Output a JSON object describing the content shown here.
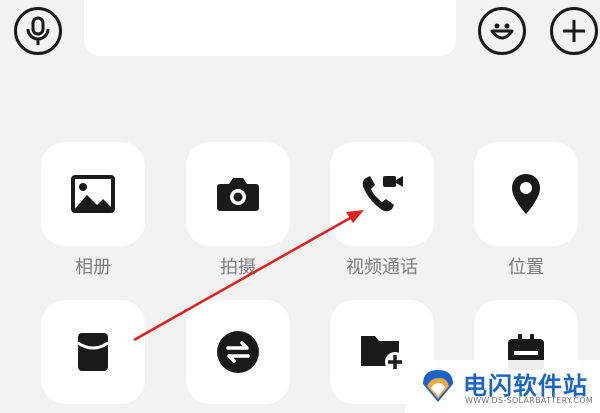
{
  "toolbar": {
    "voice_icon": "microphone-icon",
    "emoji_icon": "emoji-icon",
    "add_icon": "plus-icon",
    "input_value": ""
  },
  "apps": [
    {
      "label": "相册",
      "icon": "image-icon"
    },
    {
      "label": "拍摄",
      "icon": "camera-icon"
    },
    {
      "label": "视频通话",
      "icon": "video-call-icon"
    },
    {
      "label": "位置",
      "icon": "location-pin-icon"
    },
    {
      "label": "",
      "icon": "red-packet-icon"
    },
    {
      "label": "",
      "icon": "transfer-icon"
    },
    {
      "label": "",
      "icon": "file-add-icon"
    },
    {
      "label": "",
      "icon": "calendar-icon"
    }
  ],
  "annotation": {
    "color": "#e02020"
  },
  "watermark": {
    "title": "电闪软件站",
    "subtitle": "WWW.DS-SOLARBATTERY.COM"
  }
}
